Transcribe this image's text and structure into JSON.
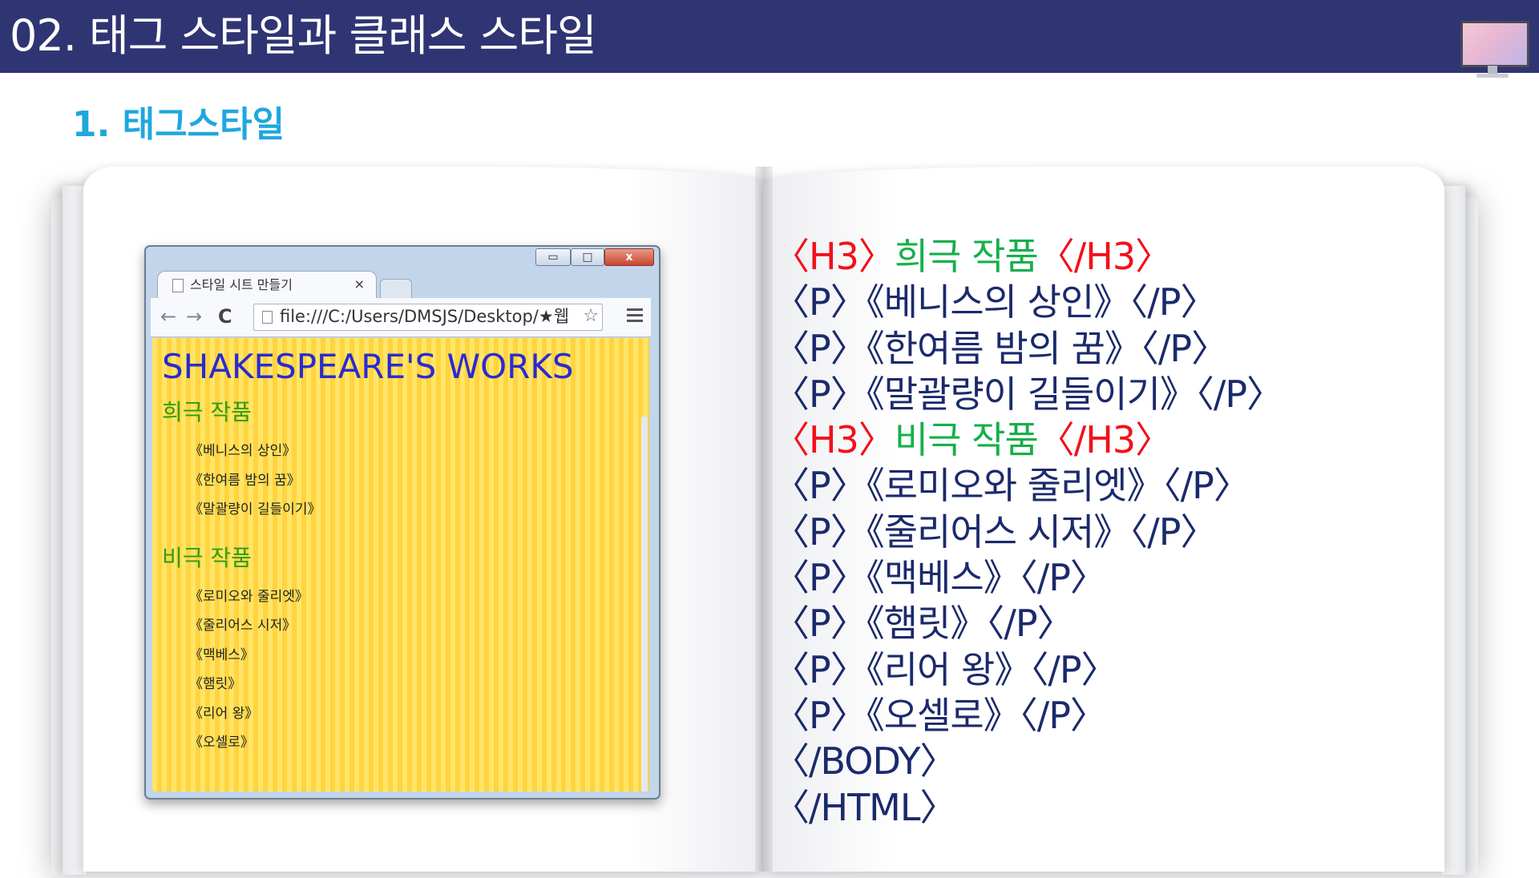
{
  "header": {
    "title": "02. 태그 스타일과 클래스 스타일"
  },
  "section": {
    "title": "1. 태그스타일"
  },
  "browser": {
    "tab_label": "스타일 시트 만들기",
    "tab_close": "×",
    "window_minimize": "▭",
    "window_maximize": "□",
    "window_close": "x",
    "nav_back": "←",
    "nav_forward": "→",
    "nav_reload": "C",
    "url": "file:///C:/Users/DMSJS/Desktop/★웹",
    "star": "☆",
    "page": {
      "title": "SHAKESPEARE'S WORKS",
      "sections": [
        {
          "heading": "희극 작품",
          "items": [
            "《베니스의 상인》",
            "《한여름 밤의 꿈》",
            "《말괄량이 길들이기》"
          ]
        },
        {
          "heading": "비극 작품",
          "items": [
            "《로미오와 줄리엣》",
            "《줄리어스 시저》",
            "《맥베스》",
            "《햄릿》",
            "《리어 왕》",
            "《오셀로》"
          ]
        }
      ]
    }
  },
  "code": {
    "lines": [
      {
        "open": "〈H3〉",
        "body": "희극 작품",
        "close": "〈/H3〉",
        "type": "h3"
      },
      {
        "text": "〈P〉《베니스의 상인》〈/P〉",
        "type": "p"
      },
      {
        "text": "〈P〉《한여름 밤의 꿈》〈/P〉",
        "type": "p"
      },
      {
        "text": "〈P〉《말괄량이 길들이기》〈/P〉",
        "type": "p"
      },
      {
        "open": "〈H3〉",
        "body": "비극 작품",
        "close": "〈/H3〉",
        "type": "h3"
      },
      {
        "text": "〈P〉《로미오와 줄리엣》〈/P〉",
        "type": "p"
      },
      {
        "text": "〈P〉《줄리어스 시저》〈/P〉",
        "type": "p"
      },
      {
        "text": "〈P〉《맥베스》〈/P〉",
        "type": "p"
      },
      {
        "text": "〈P〉《햄릿》〈/P〉",
        "type": "p"
      },
      {
        "text": "〈P〉《리어 왕》〈/P〉",
        "type": "p"
      },
      {
        "text": "〈P〉《오셀로》〈/P〉",
        "type": "p"
      },
      {
        "text": "〈/BODY〉",
        "type": "p"
      },
      {
        "text": "〈/HTML〉",
        "type": "p"
      }
    ]
  },
  "colors": {
    "header_bg": "#2f3573",
    "section_title": "#1fa7de",
    "tag_red": "#f2111a",
    "heading_green": "#16b04a",
    "code_navy": "#1b2a6b",
    "stripe_light": "#ffe567",
    "stripe_dark": "#ffd43f",
    "page_title_blue": "#2a2ad1",
    "page_heading_green": "#2f9c14"
  },
  "icons": [
    "monitor-icon",
    "page-icon",
    "back-arrow-icon",
    "forward-arrow-icon",
    "reload-icon",
    "star-icon",
    "menu-icon"
  ]
}
